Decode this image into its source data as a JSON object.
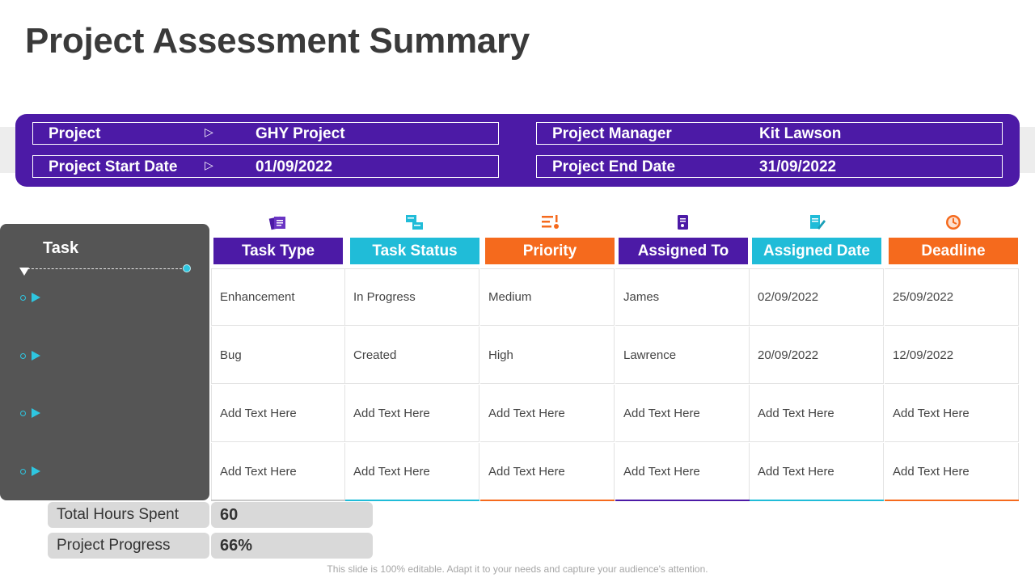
{
  "title": "Project Assessment Summary",
  "info": {
    "project_label": "Project",
    "project_value": "GHY Project",
    "start_label": "Project Start Date",
    "start_value": "01/09/2022",
    "manager_label": "Project Manager",
    "manager_value": "Kit Lawson",
    "end_label": "Project End Date",
    "end_value": "31/09/2022"
  },
  "task_header": "Task",
  "columns": [
    {
      "label": "Task Type",
      "color": "#4c1aa6",
      "icon_bg": "#d9c6f5",
      "icon": "documents-icon"
    },
    {
      "label": "Task Status",
      "color": "#20bcd8",
      "icon_bg": "#c4eef6",
      "icon": "status-cards-icon"
    },
    {
      "label": "Priority",
      "color": "#f56a1d",
      "icon_bg": "#fde0cf",
      "icon": "priority-list-icon"
    },
    {
      "label": "Assigned To",
      "color": "#4c1aa6",
      "icon_bg": "#d9c6f5",
      "icon": "assignee-document-icon"
    },
    {
      "label": "Assigned Date",
      "color": "#20bcd8",
      "icon_bg": "#c4eef6",
      "icon": "signed-document-icon"
    },
    {
      "label": "Deadline",
      "color": "#f56a1d",
      "icon_bg": "#fde0cf",
      "icon": "clock-icon"
    }
  ],
  "rows": [
    [
      "Enhancement",
      "In Progress",
      "Medium",
      "James",
      "02/09/2022",
      "25/09/2022"
    ],
    [
      "Bug",
      "Created",
      "High",
      "Lawrence",
      "20/09/2022",
      "12/09/2022"
    ],
    [
      "Add Text Here",
      "Add Text Here",
      "Add Text Here",
      "Add Text Here",
      "Add Text Here",
      "Add Text Here"
    ],
    [
      "Add Text Here",
      "Add Text Here",
      "Add Text Here",
      "Add Text Here",
      "Add Text Here",
      "Add Text Here"
    ]
  ],
  "summary": {
    "hours_label": "Total Hours Spent",
    "hours_value": "60",
    "progress_label": "Project Progress",
    "progress_value": "66%"
  },
  "footer": "This slide is 100% editable. Adapt it to your needs and capture your audience's attention."
}
